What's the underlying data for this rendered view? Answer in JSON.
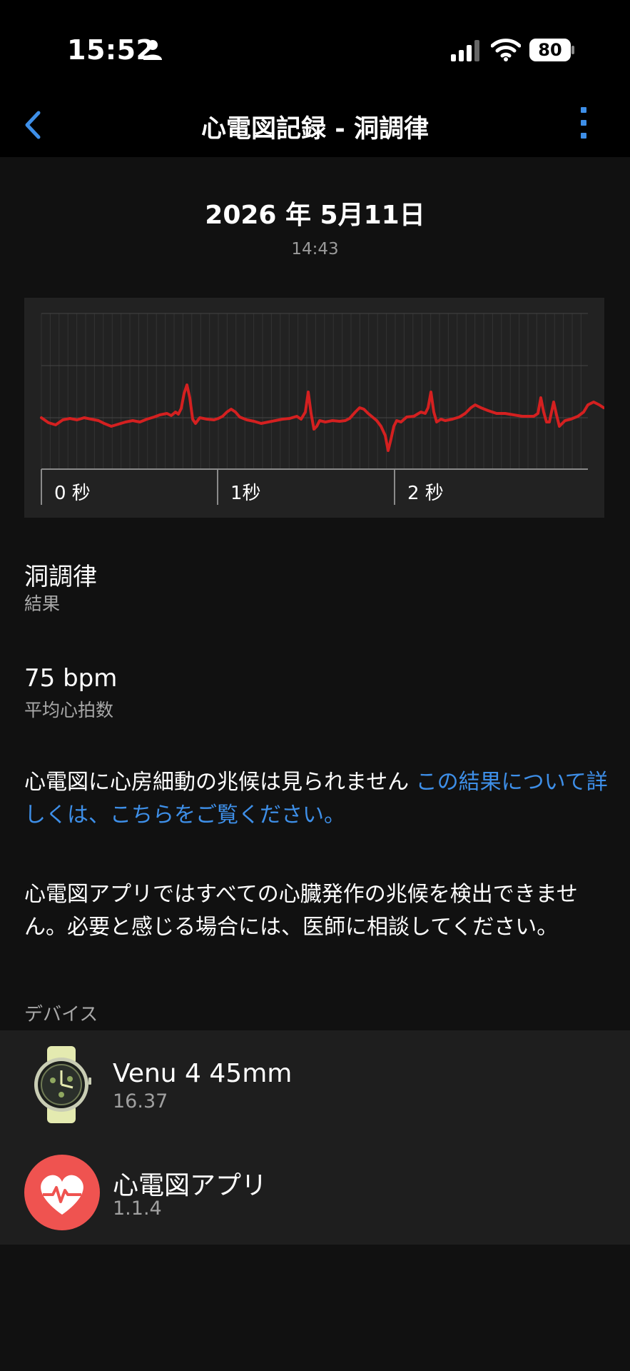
{
  "status_bar": {
    "time": "15:52",
    "battery": "80"
  },
  "nav": {
    "title": "心電図記録 - 洞調律"
  },
  "record": {
    "date": "2026 年 5月11日",
    "time": "14:43"
  },
  "ecg": {
    "time_labels": [
      "0 秒",
      "1秒",
      "2 秒"
    ],
    "trace_color": "#d42020"
  },
  "result": {
    "value": "洞調律",
    "label": "結果"
  },
  "heart_rate": {
    "value": "75 bpm",
    "label": "平均心拍数"
  },
  "info": {
    "text": "心電図に心房細動の兆候は見られません",
    "link": "この結果について詳しくは、こちらをご覧ください。"
  },
  "disclaimer": "心電図アプリではすべての心臓発作の兆候を検出できません。必要と感じる場合には、医師に相談してください。",
  "devices": {
    "header": "デバイス",
    "items": [
      {
        "name": "Venu 4 45mm",
        "version": "16.37",
        "icon": "watch-icon"
      },
      {
        "name": "心電図アプリ",
        "version": "1.1.4",
        "icon": "ecg-app-heart-icon"
      }
    ]
  },
  "colors": {
    "accent": "#3e8fe8",
    "ecg_trace": "#d42020",
    "app_icon_bg": "#ef5350"
  }
}
